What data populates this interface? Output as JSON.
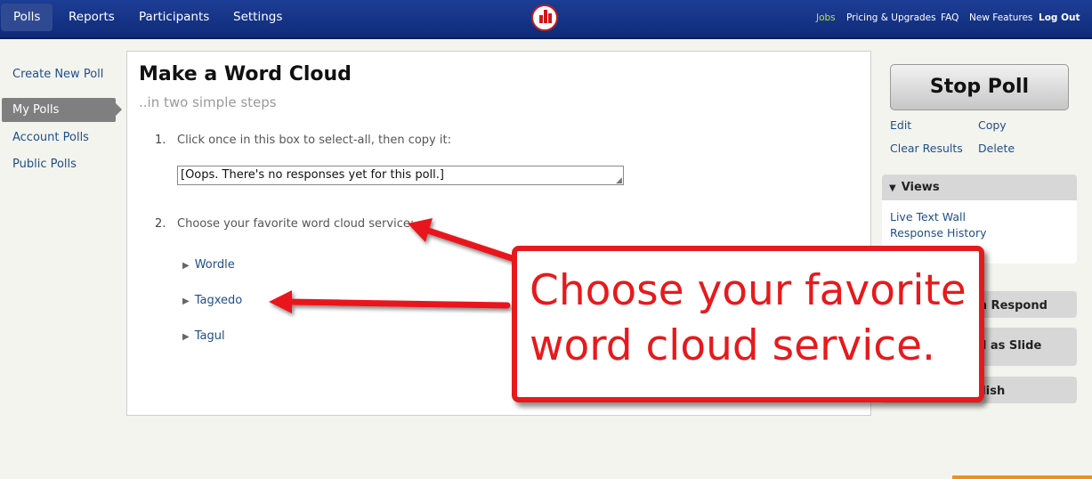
{
  "nav": {
    "tabs": [
      "Polls",
      "Reports",
      "Participants",
      "Settings"
    ],
    "links": {
      "jobs": "Jobs",
      "pricing": "Pricing & Upgrades",
      "faq": "FAQ",
      "new_features": "New Features",
      "logout": "Log Out"
    }
  },
  "sidebar": {
    "items": [
      "Create New Poll",
      "My Polls",
      "Account Polls",
      "Public Polls"
    ]
  },
  "main": {
    "title": "Make a Word Cloud",
    "subtitle": "..in two simple steps",
    "step1": {
      "num": "1.",
      "text": "Click once in this box to select-all, then copy it:"
    },
    "copy_box_value": "[Oops. There's no responses yet for this poll.]",
    "step2": {
      "num": "2.",
      "text": "Choose your favorite word cloud service:"
    },
    "services": [
      "Wordle",
      "Tagxedo",
      "Tagul"
    ]
  },
  "right": {
    "stop_button": "Stop Poll",
    "actions": {
      "edit": "Edit",
      "copy": "Copy",
      "clear": "Clear Results",
      "delete": "Delete"
    },
    "views": {
      "header": "Views",
      "items": [
        "Live Text Wall",
        "Response History"
      ]
    },
    "boxes": [
      "an Respond",
      "d as Slide",
      "blish"
    ]
  },
  "callout": {
    "text": "Choose your favorite word cloud service."
  },
  "colors": {
    "nav_bg": "#1d3e96",
    "link": "#1f4e8c",
    "annotation_red": "#e8191b"
  },
  "icons": [
    "logo-icon",
    "triangle-right-icon",
    "triangle-down-icon",
    "resize-grip-icon",
    "arrow-icon"
  ]
}
